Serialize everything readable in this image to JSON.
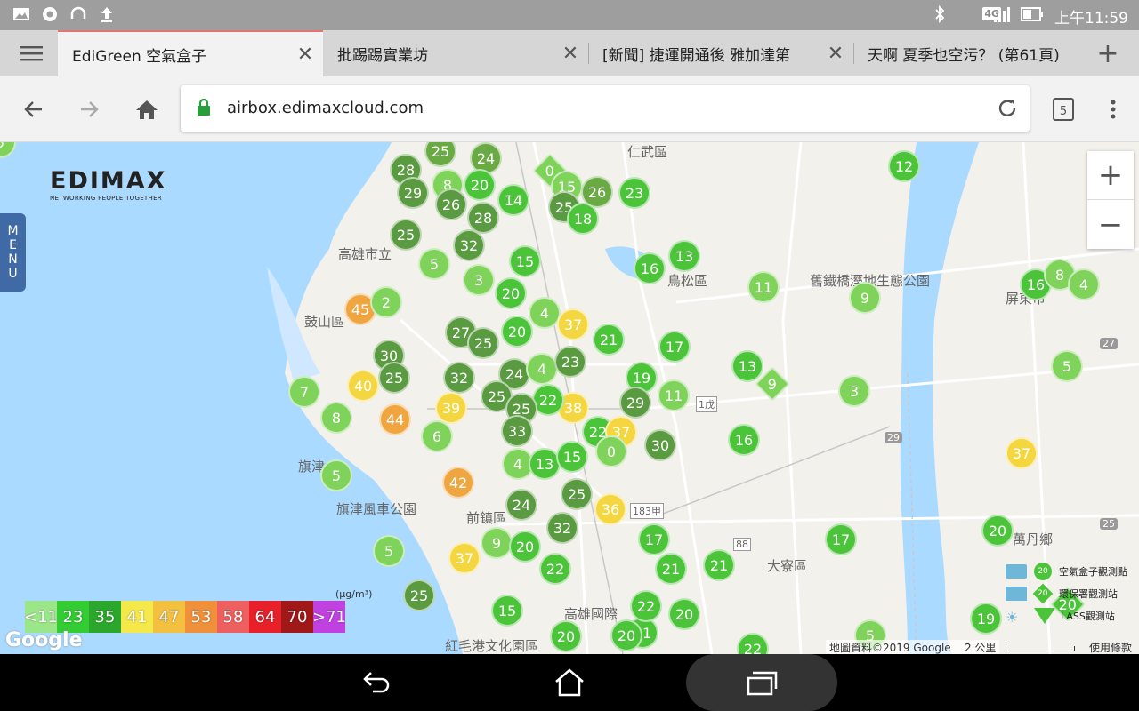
{
  "status_bar": {
    "time": "上午11:59",
    "network": "4G"
  },
  "tabs": [
    {
      "title": "EdiGreen 空氣盒子",
      "active": true
    },
    {
      "title": "批踢踢實業坊",
      "active": false
    },
    {
      "title": "[新聞] 捷運開通後 雅加達第",
      "active": false
    },
    {
      "title": "天啊 夏季也空污？ (第61頁)",
      "active": false
    }
  ],
  "toolbar": {
    "url": "airbox.edimaxcloud.com",
    "tab_count": "5"
  },
  "logo": {
    "brand": "EDIMAX",
    "tagline": "NETWORKING PEOPLE TOGETHER"
  },
  "menu_label": [
    "M",
    "E",
    "N",
    "U"
  ],
  "zoom": {
    "in": "+",
    "out": "−"
  },
  "place_labels": [
    "仁武區",
    "高雄市立",
    "鳥松區",
    "舊鐵橋溼地生態公園",
    "鼓山區",
    "旗津",
    "旗津風車公園",
    "前鎮區",
    "高雄國際",
    "紅毛港文化園區",
    "大寮區",
    "萬丹鄉",
    "屏東市",
    "183甲",
    "88",
    "1戊",
    "29",
    "27",
    "25"
  ],
  "markers": [
    {
      "v": "25",
      "c": "#6aaa44"
    },
    {
      "v": "24",
      "c": "#6aaa44"
    },
    {
      "v": "28",
      "c": "#5a9a40"
    },
    {
      "v": "8",
      "c": "#7fd35a"
    },
    {
      "v": "20",
      "c": "#4cc43a"
    },
    {
      "v": "0",
      "c": "#7fd35a",
      "d": true
    },
    {
      "v": "15",
      "c": "#7fd35a"
    },
    {
      "v": "26",
      "c": "#6aaa44"
    },
    {
      "v": "23",
      "c": "#4cc43a"
    },
    {
      "v": "12",
      "c": "#4cc43a"
    },
    {
      "v": "29",
      "c": "#5a9a40"
    },
    {
      "v": "26",
      "c": "#5a9a40"
    },
    {
      "v": "14",
      "c": "#4cc43a"
    },
    {
      "v": "25",
      "c": "#5a9a40"
    },
    {
      "v": "18",
      "c": "#4cc43a"
    },
    {
      "v": "28",
      "c": "#5a9a40"
    },
    {
      "v": "25",
      "c": "#5a9a40"
    },
    {
      "v": "32",
      "c": "#5a9a40"
    },
    {
      "v": "15",
      "c": "#4cc43a"
    },
    {
      "v": "16",
      "c": "#4cc43a"
    },
    {
      "v": "13",
      "c": "#4cc43a"
    },
    {
      "v": "5",
      "c": "#7fd35a"
    },
    {
      "v": "3",
      "c": "#7fd35a"
    },
    {
      "v": "20",
      "c": "#4cc43a"
    },
    {
      "v": "11",
      "c": "#7fd35a"
    },
    {
      "v": "9",
      "c": "#7fd35a"
    },
    {
      "v": "16",
      "c": "#4cc43a"
    },
    {
      "v": "8",
      "c": "#7fd35a"
    },
    {
      "v": "4",
      "c": "#7fd35a"
    },
    {
      "v": "45",
      "c": "#f0a640"
    },
    {
      "v": "2",
      "c": "#7fd35a"
    },
    {
      "v": "4",
      "c": "#7fd35a"
    },
    {
      "v": "37",
      "c": "#f4d640"
    },
    {
      "v": "27",
      "c": "#5a9a40"
    },
    {
      "v": "25",
      "c": "#5a9a40"
    },
    {
      "v": "20",
      "c": "#4cc43a"
    },
    {
      "v": "21",
      "c": "#4cc43a"
    },
    {
      "v": "17",
      "c": "#4cc43a"
    },
    {
      "v": "30",
      "c": "#5a9a40"
    },
    {
      "v": "25",
      "c": "#5a9a40"
    },
    {
      "v": "32",
      "c": "#5a9a40"
    },
    {
      "v": "24",
      "c": "#5a9a40"
    },
    {
      "v": "4",
      "c": "#7fd35a"
    },
    {
      "v": "23",
      "c": "#5a9a40"
    },
    {
      "v": "13",
      "c": "#4cc43a"
    },
    {
      "v": "9",
      "c": "#7fd35a",
      "d": true
    },
    {
      "v": "5",
      "c": "#7fd35a"
    },
    {
      "v": "7",
      "c": "#7fd35a"
    },
    {
      "v": "40",
      "c": "#f4d640"
    },
    {
      "v": "25",
      "c": "#5a9a40"
    },
    {
      "v": "19",
      "c": "#4cc43a"
    },
    {
      "v": "11",
      "c": "#7fd35a"
    },
    {
      "v": "3",
      "c": "#7fd35a"
    },
    {
      "v": "8",
      "c": "#7fd35a"
    },
    {
      "v": "44",
      "c": "#f0a640"
    },
    {
      "v": "39",
      "c": "#f4d640"
    },
    {
      "v": "38",
      "c": "#f4d640"
    },
    {
      "v": "29",
      "c": "#5a9a40"
    },
    {
      "v": "22",
      "c": "#4cc43a"
    },
    {
      "v": "25",
      "c": "#5a9a40"
    },
    {
      "v": "6",
      "c": "#7fd35a"
    },
    {
      "v": "33",
      "c": "#5a9a40"
    },
    {
      "v": "22",
      "c": "#4cc43a"
    },
    {
      "v": "37",
      "c": "#f4d640"
    },
    {
      "v": "30",
      "c": "#5a9a40"
    },
    {
      "v": "16",
      "c": "#4cc43a"
    },
    {
      "v": "0",
      "c": "#7fd35a"
    },
    {
      "v": "4",
      "c": "#7fd35a"
    },
    {
      "v": "13",
      "c": "#4cc43a"
    },
    {
      "v": "15",
      "c": "#4cc43a"
    },
    {
      "v": "37",
      "c": "#f4d640"
    },
    {
      "v": "5",
      "c": "#7fd35a"
    },
    {
      "v": "42",
      "c": "#f0a640"
    },
    {
      "v": "25",
      "c": "#5a9a40"
    },
    {
      "v": "36",
      "c": "#f4d640"
    },
    {
      "v": "24",
      "c": "#5a9a40"
    },
    {
      "v": "32",
      "c": "#5a9a40"
    },
    {
      "v": "17",
      "c": "#4cc43a"
    },
    {
      "v": "17",
      "c": "#4cc43a"
    },
    {
      "v": "20",
      "c": "#4cc43a"
    },
    {
      "v": "5",
      "c": "#7fd35a"
    },
    {
      "v": "37",
      "c": "#f4d640"
    },
    {
      "v": "9",
      "c": "#7fd35a"
    },
    {
      "v": "20",
      "c": "#4cc43a"
    },
    {
      "v": "22",
      "c": "#4cc43a"
    },
    {
      "v": "21",
      "c": "#4cc43a"
    },
    {
      "v": "21",
      "c": "#4cc43a"
    },
    {
      "v": "25",
      "c": "#5a9a40"
    },
    {
      "v": "15",
      "c": "#4cc43a"
    },
    {
      "v": "21",
      "c": "#4cc43a"
    },
    {
      "v": "22",
      "c": "#4cc43a"
    },
    {
      "v": "20",
      "c": "#4cc43a"
    },
    {
      "v": "20",
      "c": "#4cc43a"
    },
    {
      "v": "20",
      "c": "#4cc43a"
    },
    {
      "v": "22",
      "c": "#4cc43a"
    },
    {
      "v": "19",
      "c": "#4cc43a"
    },
    {
      "v": "5",
      "c": "#7fd35a"
    },
    {
      "v": "20",
      "c": "#4cc43a",
      "d": true
    },
    {
      "v": "5",
      "c": "#7fd35a"
    }
  ],
  "legend": {
    "unit": "(μg/m³)",
    "items": [
      {
        "label": "<11",
        "color": "#9ce68a"
      },
      {
        "label": "23",
        "color": "#33cc33"
      },
      {
        "label": "35",
        "color": "#2ba82b"
      },
      {
        "label": "41",
        "color": "#f4e84a"
      },
      {
        "label": "47",
        "color": "#f4c040"
      },
      {
        "label": "53",
        "color": "#f0903a"
      },
      {
        "label": "58",
        "color": "#ee6060"
      },
      {
        "label": "64",
        "color": "#e8202a"
      },
      {
        "label": "70",
        "color": "#a01818"
      },
      {
        "label": ">71",
        "color": "#c040e0"
      }
    ]
  },
  "map_legend": [
    {
      "icon": "空氣盒子",
      "badge": "20",
      "label": "空氣盒子觀測點"
    },
    {
      "icon": "環保署",
      "badge": "20",
      "label": "環保署觀測站"
    },
    {
      "icon": "LASS",
      "badge": "20",
      "label": "LASS觀測站"
    }
  ],
  "attribution": {
    "google": "Google",
    "data": "地圖資料©2019 Google",
    "scale": "2 公里",
    "terms": "使用條款"
  }
}
